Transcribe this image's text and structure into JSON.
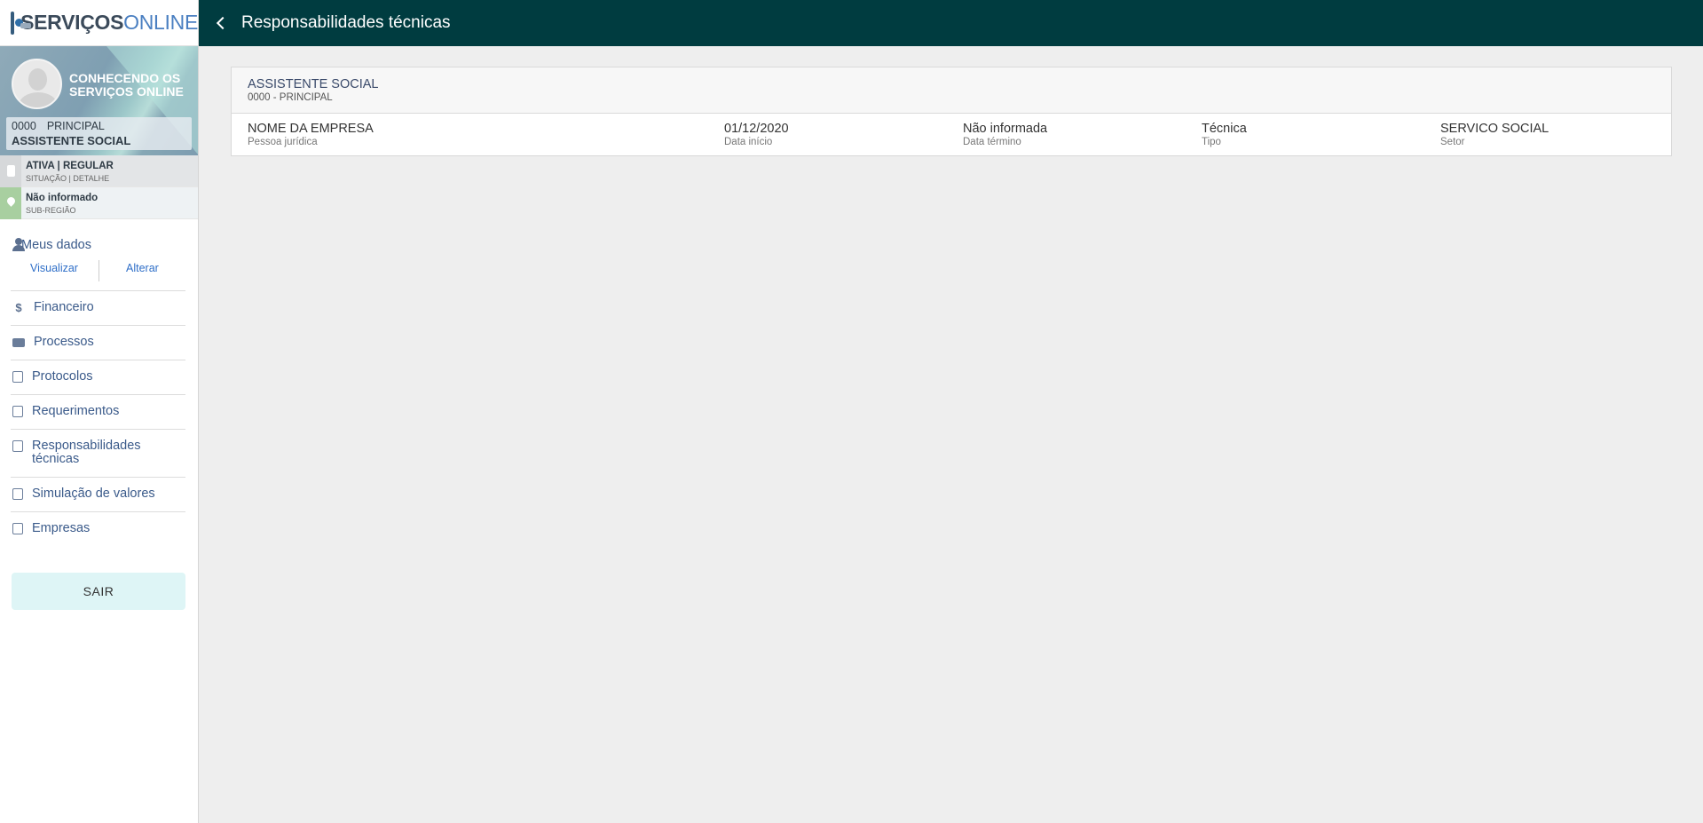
{
  "logo": {
    "part1": "SERVIÇOS",
    "part2": "ONLINE"
  },
  "profile": {
    "name": "CONHECENDO OS SERVIÇOS ONLINE",
    "registration": "0000",
    "kind": "PRINCIPAL",
    "profession": "ASSISTENTE SOCIAL"
  },
  "status": {
    "situation": "ATIVA | REGULAR",
    "situation_label": "SITUAÇÃO | DETALHE",
    "region": "Não informado",
    "region_label": "SUB-REGIÃO"
  },
  "menu": {
    "meus_dados": {
      "label": "Meus dados",
      "view": "Visualizar",
      "edit": "Alterar"
    },
    "items": [
      {
        "label": "Financeiro",
        "icon": "dollar-icon"
      },
      {
        "label": "Processos",
        "icon": "folder-icon"
      },
      {
        "label": "Protocolos",
        "icon": "document-icon"
      },
      {
        "label": "Requerimentos",
        "icon": "clipboard-icon"
      },
      {
        "label": "Responsabilidades técnicas",
        "icon": "clipboard-icon"
      },
      {
        "label": "Simulação de valores",
        "icon": "clipboard-icon"
      },
      {
        "label": "Empresas",
        "icon": "clipboard-icon"
      }
    ],
    "logout": "SAIR"
  },
  "header": {
    "title": "Responsabilidades técnicas"
  },
  "card": {
    "title": "ASSISTENTE SOCIAL",
    "subtitle": "0000 - PRINCIPAL",
    "company": {
      "value": "NOME DA EMPRESA",
      "label": "Pessoa jurídica"
    },
    "start": {
      "value": "01/12/2020",
      "label": "Data início"
    },
    "end": {
      "value": "Não informada",
      "label": "Data término"
    },
    "type": {
      "value": "Técnica",
      "label": "Tipo"
    },
    "sector": {
      "value": "SERVICO SOCIAL",
      "label": "Setor"
    }
  },
  "colors": {
    "header": "#003c40",
    "link": "#2f6fc8",
    "menu_text": "#3a5a8a",
    "logout_bg": "#def5f6"
  }
}
